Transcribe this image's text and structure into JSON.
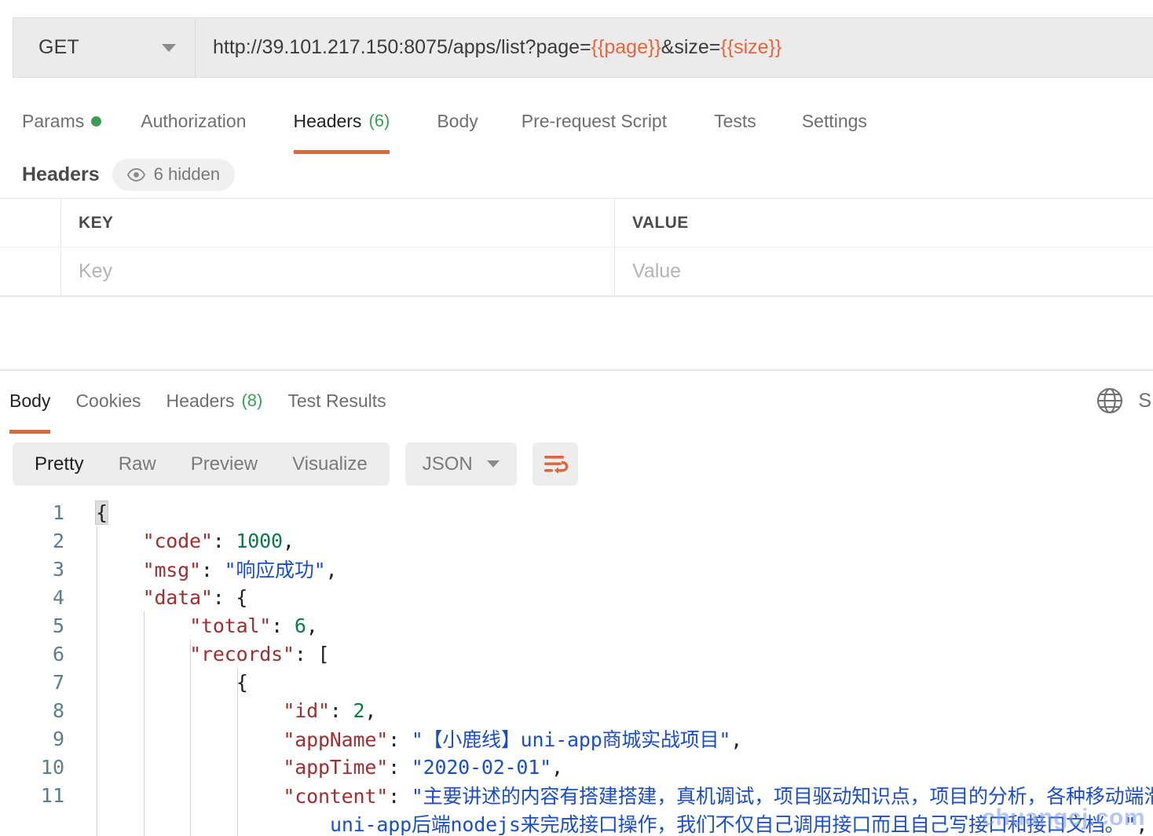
{
  "request": {
    "method": "GET",
    "url_prefix": "http://39.101.217.150:8075/apps/list?page=",
    "url_var1": "{{page}}",
    "url_mid": "&size=",
    "url_var2": "{{size}}",
    "tabs": [
      {
        "label": "Params",
        "dot": true,
        "count": "",
        "active": false
      },
      {
        "label": "Authorization",
        "dot": false,
        "count": "",
        "active": false
      },
      {
        "label": "Headers",
        "dot": false,
        "count": "(6)",
        "active": true
      },
      {
        "label": "Body",
        "dot": false,
        "count": "",
        "active": false
      },
      {
        "label": "Pre-request Script",
        "dot": false,
        "count": "",
        "active": false
      },
      {
        "label": "Tests",
        "dot": false,
        "count": "",
        "active": false
      },
      {
        "label": "Settings",
        "dot": false,
        "count": "",
        "active": false
      }
    ]
  },
  "headers_panel": {
    "title": "Headers",
    "hidden_badge": "6 hidden",
    "columns": {
      "key": "KEY",
      "value": "VALUE"
    },
    "row": {
      "key_placeholder": "Key",
      "value_placeholder": "Value"
    }
  },
  "response": {
    "tabs": [
      {
        "label": "Body",
        "count": "",
        "active": true
      },
      {
        "label": "Cookies",
        "count": "",
        "active": false
      },
      {
        "label": "Headers",
        "count": "(8)",
        "active": false
      },
      {
        "label": "Test Results",
        "count": "",
        "active": false
      }
    ],
    "save_label": "S",
    "toolbar": {
      "views": [
        {
          "label": "Pretty",
          "active": true
        },
        {
          "label": "Raw",
          "active": false
        },
        {
          "label": "Preview",
          "active": false
        },
        {
          "label": "Visualize",
          "active": false
        }
      ],
      "format": "JSON",
      "wrap_icon": "wrap-text-icon"
    },
    "body_lines": [
      {
        "num": "1",
        "indent": 0,
        "tokens": [
          {
            "t": "p",
            "v": "{"
          }
        ]
      },
      {
        "num": "2",
        "indent": 1,
        "tokens": [
          {
            "t": "k",
            "v": "\"code\""
          },
          {
            "t": "p",
            "v": ": "
          },
          {
            "t": "n",
            "v": "1000"
          },
          {
            "t": "p",
            "v": ","
          }
        ]
      },
      {
        "num": "3",
        "indent": 1,
        "tokens": [
          {
            "t": "k",
            "v": "\"msg\""
          },
          {
            "t": "p",
            "v": ": "
          },
          {
            "t": "s",
            "v": "\"响应成功\""
          },
          {
            "t": "p",
            "v": ","
          }
        ]
      },
      {
        "num": "4",
        "indent": 1,
        "tokens": [
          {
            "t": "k",
            "v": "\"data\""
          },
          {
            "t": "p",
            "v": ": {"
          }
        ]
      },
      {
        "num": "5",
        "indent": 2,
        "tokens": [
          {
            "t": "k",
            "v": "\"total\""
          },
          {
            "t": "p",
            "v": ": "
          },
          {
            "t": "n",
            "v": "6"
          },
          {
            "t": "p",
            "v": ","
          }
        ]
      },
      {
        "num": "6",
        "indent": 2,
        "tokens": [
          {
            "t": "k",
            "v": "\"records\""
          },
          {
            "t": "p",
            "v": ": ["
          }
        ]
      },
      {
        "num": "7",
        "indent": 3,
        "tokens": [
          {
            "t": "p",
            "v": "{"
          }
        ]
      },
      {
        "num": "8",
        "indent": 4,
        "tokens": [
          {
            "t": "k",
            "v": "\"id\""
          },
          {
            "t": "p",
            "v": ": "
          },
          {
            "t": "n",
            "v": "2"
          },
          {
            "t": "p",
            "v": ","
          }
        ]
      },
      {
        "num": "9",
        "indent": 4,
        "tokens": [
          {
            "t": "k",
            "v": "\"appName\""
          },
          {
            "t": "p",
            "v": ": "
          },
          {
            "t": "s",
            "v": "\"【小鹿线】uni-app商城实战项目\""
          },
          {
            "t": "p",
            "v": ","
          }
        ]
      },
      {
        "num": "10",
        "indent": 4,
        "tokens": [
          {
            "t": "k",
            "v": "\"appTime\""
          },
          {
            "t": "p",
            "v": ": "
          },
          {
            "t": "s",
            "v": "\"2020-02-01\""
          },
          {
            "t": "p",
            "v": ","
          }
        ]
      },
      {
        "num": "11",
        "indent": 4,
        "tokens": [
          {
            "t": "k",
            "v": "\"content\""
          },
          {
            "t": "p",
            "v": ": "
          },
          {
            "t": "s",
            "v": "\"主要讲述的内容有搭建搭建，真机调试，项目驱动知识点，项目的分析，各种移动端滑动"
          }
        ]
      },
      {
        "num": "",
        "indent": 5,
        "tokens": [
          {
            "t": "s",
            "v": "uni-app后端nodejs来完成接口操作，我们不仅自己调用接口而且自己写接口和接口文档。\""
          },
          {
            "t": "p",
            "v": ","
          }
        ]
      }
    ],
    "watermark": "chuangcj.com"
  },
  "colors": {
    "accent": "#e0663b",
    "green": "#3a9e54",
    "json_key": "#9c2f2f",
    "json_string": "#1a4fc4",
    "json_number": "#0c7a46",
    "line_number": "#5b7d8c"
  }
}
